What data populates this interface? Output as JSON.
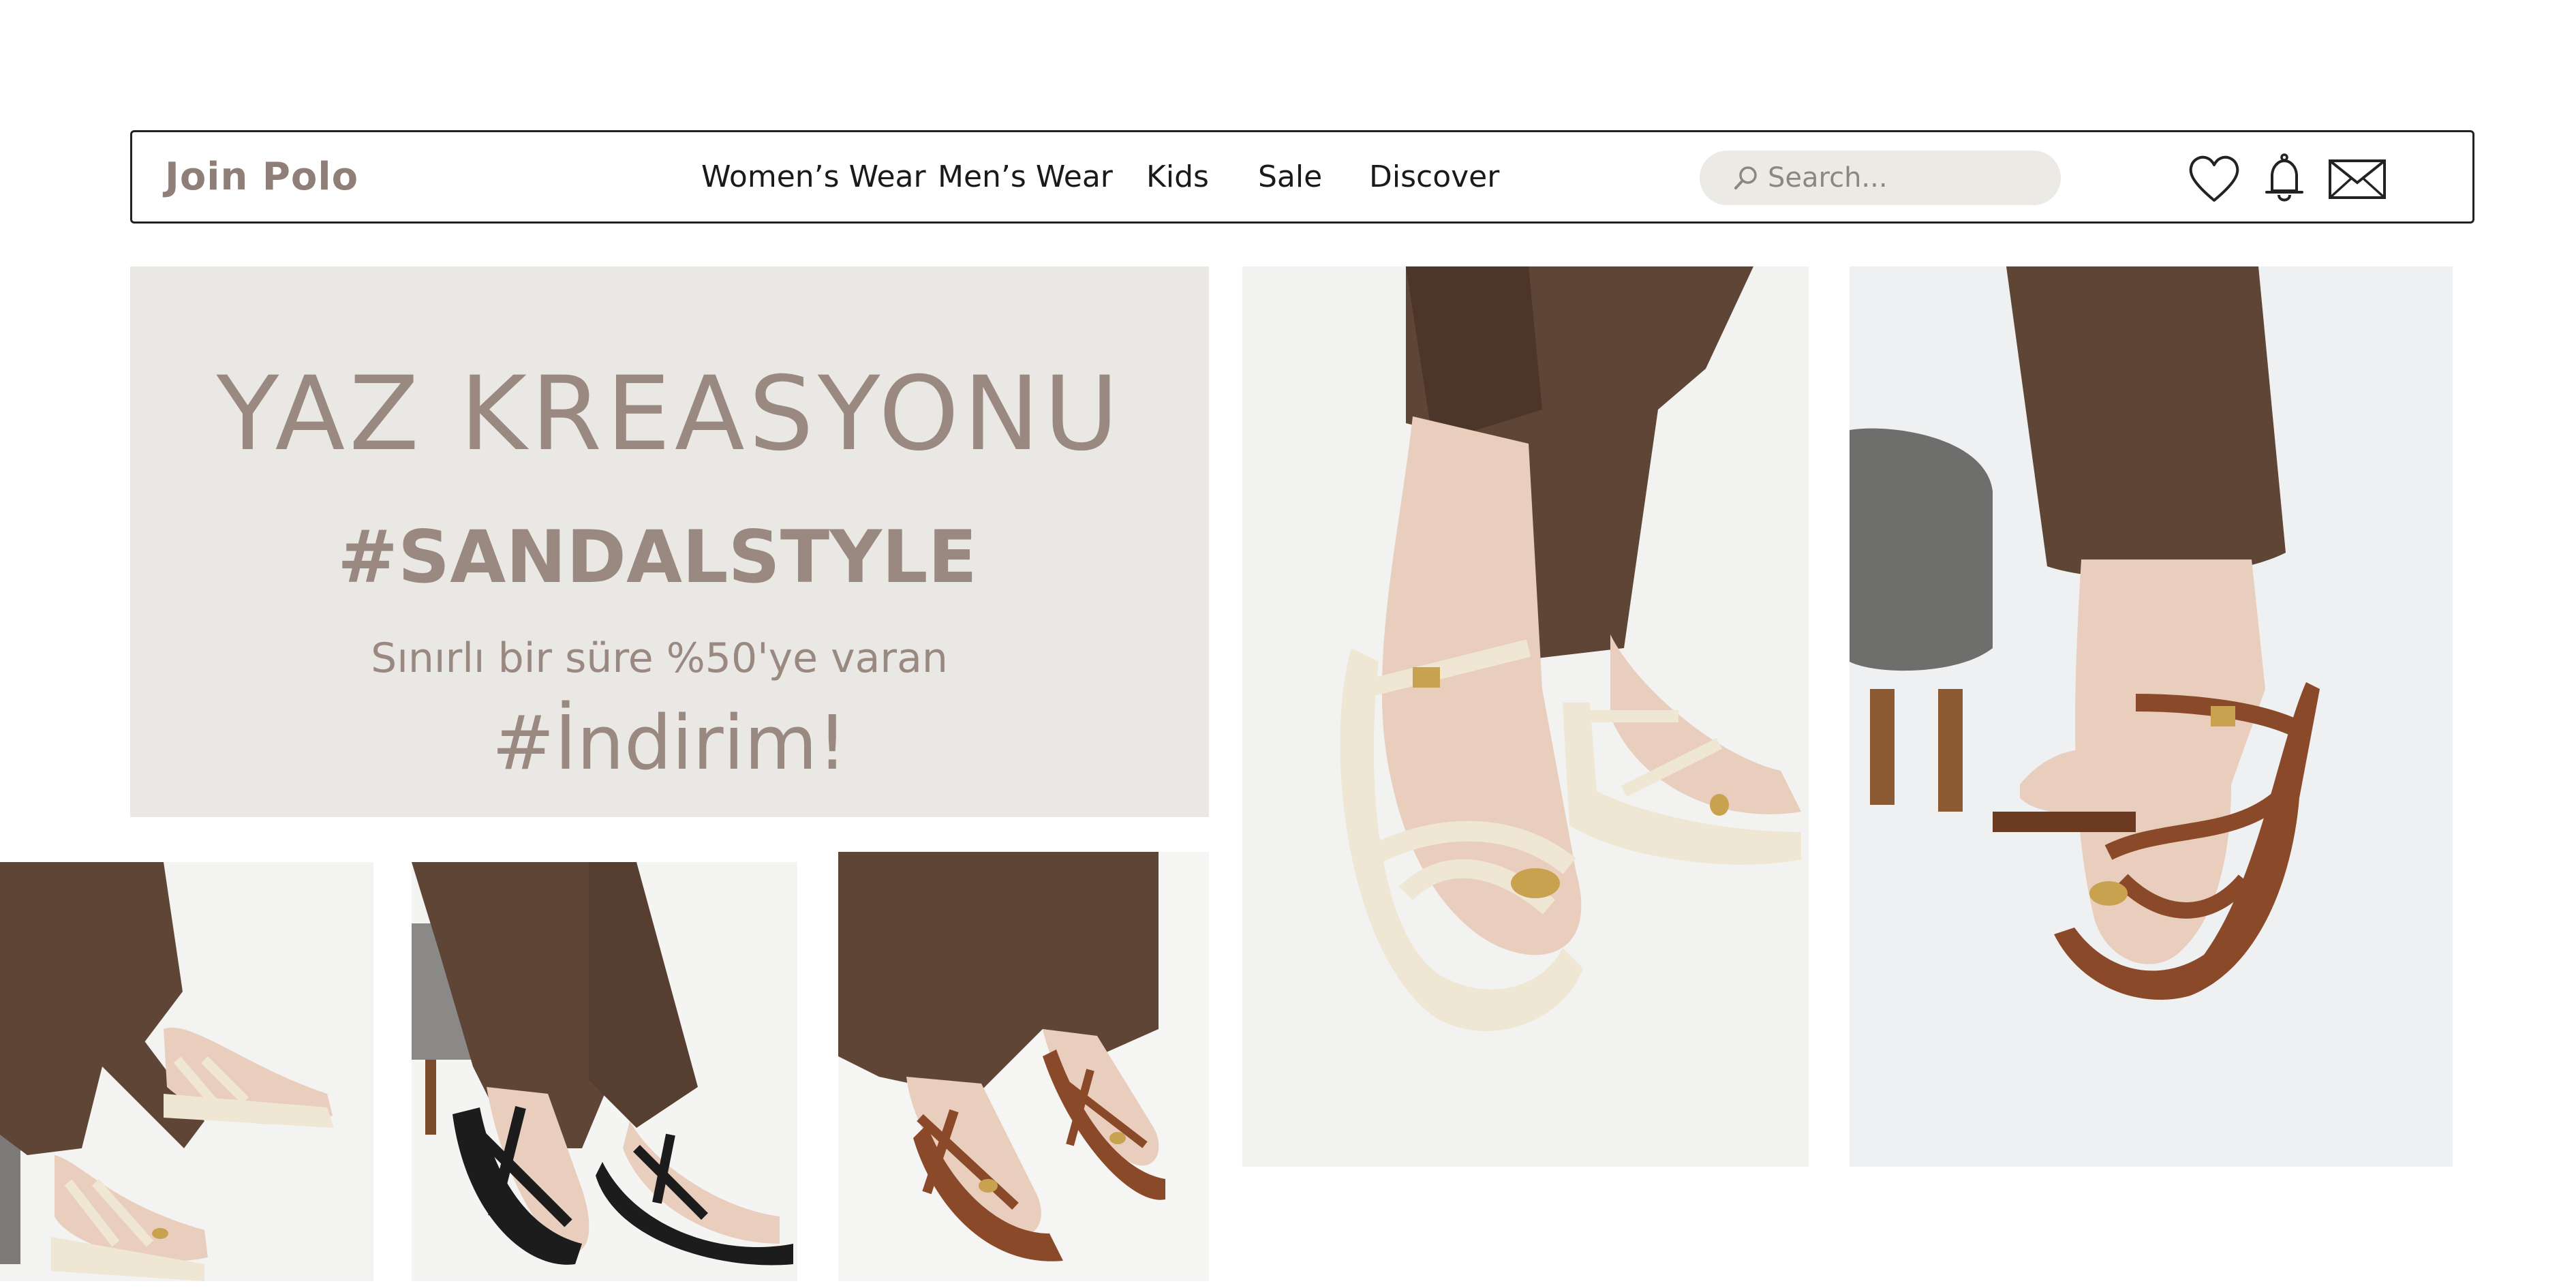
{
  "brand": {
    "logo": "Join Polo"
  },
  "nav": [
    {
      "label": "Women’s Wear"
    },
    {
      "label": "Men’s Wear"
    },
    {
      "label": "Kids"
    },
    {
      "label": "Sale"
    },
    {
      "label": "Discover"
    }
  ],
  "search": {
    "placeholder": "Search...",
    "value": ""
  },
  "header_icons": [
    "heart-icon",
    "bell-icon",
    "mail-icon"
  ],
  "promo": {
    "title": "YAZ KREASYONU",
    "hashtag": "#SANDALSTYLE",
    "subtitle": "Sınırlı bir süre %50'ye varan",
    "discount": "#İndirim!"
  },
  "colors": {
    "accent": "#9a8981",
    "promo_bg": "#eae8e5",
    "search_bg": "#eceae5",
    "pants": "#5e4536",
    "sandal_cream": "#efe6d4",
    "sandal_brown": "#8a4a2a",
    "sandal_black": "#1c1c1c"
  },
  "photos": [
    {
      "name": "photo-cream-sandals-side"
    },
    {
      "name": "photo-black-sandals"
    },
    {
      "name": "photo-brown-sandals-top"
    },
    {
      "name": "photo-cream-sandals-closeup"
    },
    {
      "name": "photo-brown-sandals-closeup"
    }
  ]
}
